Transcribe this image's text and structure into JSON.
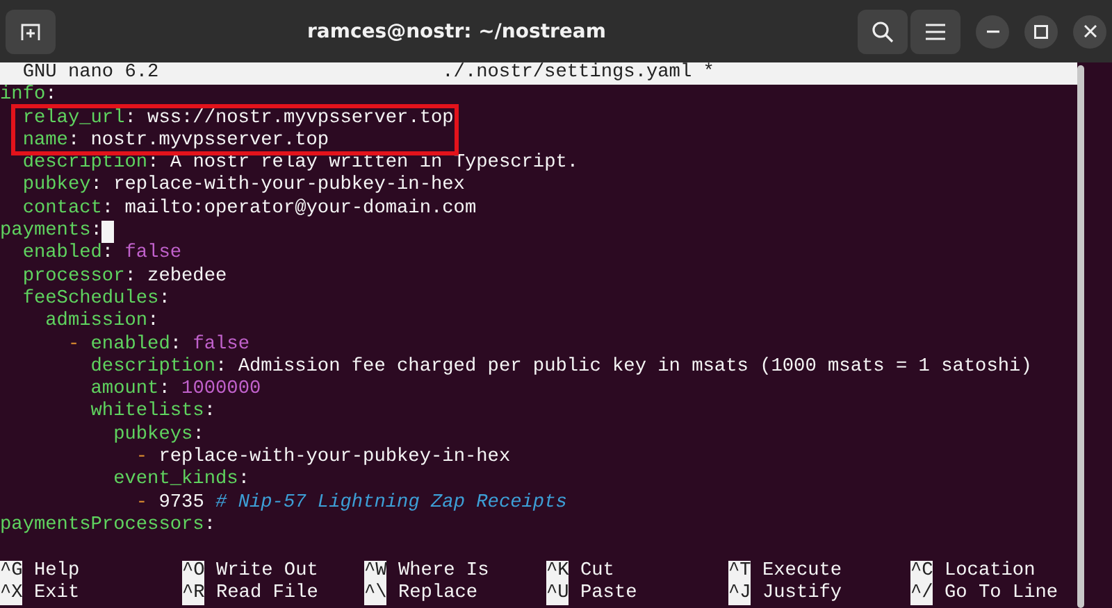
{
  "window": {
    "title": "ramces@nostr: ~/nostream"
  },
  "nano": {
    "version": "GNU nano 6.2",
    "filename": "./.nostr/settings.yaml *",
    "lines": [
      {
        "segments": [
          {
            "kind": "key",
            "text": "info"
          },
          {
            "kind": "plain",
            "text": ":"
          }
        ]
      },
      {
        "highlighted": true,
        "segments": [
          {
            "kind": "key",
            "text": "  relay_url"
          },
          {
            "kind": "plain",
            "text": ": wss://nostr.myvpsserver.top"
          }
        ]
      },
      {
        "highlighted": true,
        "segments": [
          {
            "kind": "key",
            "text": "  name"
          },
          {
            "kind": "plain",
            "text": ": nostr.myvpsserver.top"
          }
        ]
      },
      {
        "segments": [
          {
            "kind": "key",
            "text": "  description"
          },
          {
            "kind": "plain",
            "text": ": A nostr relay written in Typescript."
          }
        ]
      },
      {
        "segments": [
          {
            "kind": "key",
            "text": "  pubkey"
          },
          {
            "kind": "plain",
            "text": ": replace-with-your-pubkey-in-hex"
          }
        ]
      },
      {
        "segments": [
          {
            "kind": "key",
            "text": "  contact"
          },
          {
            "kind": "plain",
            "text": ": mailto:operator@your-domain.com"
          }
        ]
      },
      {
        "cursor": true,
        "segments": [
          {
            "kind": "key",
            "text": "payments"
          },
          {
            "kind": "plain",
            "text": ":"
          }
        ]
      },
      {
        "segments": [
          {
            "kind": "key",
            "text": "  enabled"
          },
          {
            "kind": "plain",
            "text": ": "
          },
          {
            "kind": "literal",
            "text": "false"
          }
        ]
      },
      {
        "segments": [
          {
            "kind": "key",
            "text": "  processor"
          },
          {
            "kind": "plain",
            "text": ": zebedee"
          }
        ]
      },
      {
        "segments": [
          {
            "kind": "key",
            "text": "  feeSchedules"
          },
          {
            "kind": "plain",
            "text": ":"
          }
        ]
      },
      {
        "segments": [
          {
            "kind": "key",
            "text": "    admission"
          },
          {
            "kind": "plain",
            "text": ":"
          }
        ]
      },
      {
        "segments": [
          {
            "kind": "dash",
            "text": "      - "
          },
          {
            "kind": "key",
            "text": "enabled"
          },
          {
            "kind": "plain",
            "text": ": "
          },
          {
            "kind": "literal",
            "text": "false"
          }
        ]
      },
      {
        "segments": [
          {
            "kind": "key",
            "text": "        description"
          },
          {
            "kind": "plain",
            "text": ": Admission fee charged per public key in msats (1000 msats = 1 satoshi)"
          }
        ]
      },
      {
        "segments": [
          {
            "kind": "key",
            "text": "        amount"
          },
          {
            "kind": "plain",
            "text": ": "
          },
          {
            "kind": "literal",
            "text": "1000000"
          }
        ]
      },
      {
        "segments": [
          {
            "kind": "key",
            "text": "        whitelists"
          },
          {
            "kind": "plain",
            "text": ":"
          }
        ]
      },
      {
        "segments": [
          {
            "kind": "key",
            "text": "          pubkeys"
          },
          {
            "kind": "plain",
            "text": ":"
          }
        ]
      },
      {
        "segments": [
          {
            "kind": "dash",
            "text": "            - "
          },
          {
            "kind": "plain",
            "text": "replace-with-your-pubkey-in-hex"
          }
        ]
      },
      {
        "segments": [
          {
            "kind": "key",
            "text": "          event_kinds"
          },
          {
            "kind": "plain",
            "text": ":"
          }
        ]
      },
      {
        "segments": [
          {
            "kind": "dash",
            "text": "            - "
          },
          {
            "kind": "plain",
            "text": "9735 "
          },
          {
            "kind": "comment",
            "text": "# Nip-57 Lightning Zap Receipts"
          }
        ]
      },
      {
        "segments": [
          {
            "kind": "key",
            "text": "paymentsProcessors"
          },
          {
            "kind": "plain",
            "text": ":"
          }
        ]
      }
    ],
    "shortcuts": [
      [
        {
          "key": "^G",
          "label": "Help"
        },
        {
          "key": "^O",
          "label": "Write Out"
        },
        {
          "key": "^W",
          "label": "Where Is"
        },
        {
          "key": "^K",
          "label": "Cut"
        },
        {
          "key": "^T",
          "label": "Execute"
        },
        {
          "key": "^C",
          "label": "Location"
        }
      ],
      [
        {
          "key": "^X",
          "label": "Exit"
        },
        {
          "key": "^R",
          "label": "Read File"
        },
        {
          "key": "^\\",
          "label": "Replace"
        },
        {
          "key": "^U",
          "label": "Paste"
        },
        {
          "key": "^J",
          "label": "Justify"
        },
        {
          "key": "^/",
          "label": "Go To Line"
        }
      ]
    ]
  }
}
